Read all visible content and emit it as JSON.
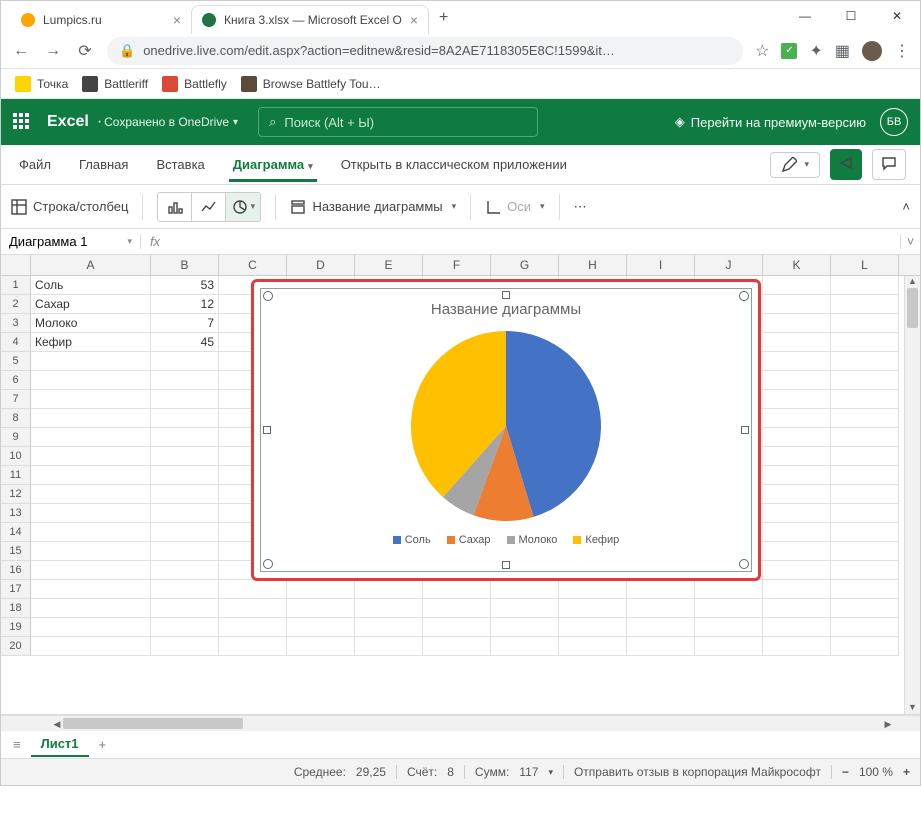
{
  "chrome": {
    "tabs": [
      {
        "title": "Lumpics.ru"
      },
      {
        "title": "Книга 3.xlsx — Microsoft Excel O"
      }
    ],
    "url": "onedrive.live.com/edit.aspx?action=editnew&resid=8A2AE7118305E8C!1599&it…",
    "bookmarks": [
      "Точка",
      "Battleriff",
      "Battlefly",
      "Browse Battlefy Tou…"
    ]
  },
  "excel_header": {
    "app": "Excel",
    "save_state": "Сохранено в OneDrive",
    "search_placeholder": "Поиск (Alt + Ы)",
    "premium": "Перейти на премиум-версию",
    "avatar_initials": "БВ"
  },
  "ribbon": {
    "tabs": [
      "Файл",
      "Главная",
      "Вставка",
      "Диаграмма"
    ],
    "active_tab": "Диаграмма",
    "open_desktop": "Открыть в классическом приложении"
  },
  "toolbar": {
    "swap_label": "Строка/столбец",
    "chart_title_label": "Название диаграммы",
    "axes_label": "Оси"
  },
  "namebox": "Диаграмма 1",
  "columns": [
    "A",
    "B",
    "C",
    "D",
    "E",
    "F",
    "G",
    "H",
    "I",
    "J",
    "K",
    "L"
  ],
  "row_count": 20,
  "cells": {
    "A1": "Соль",
    "B1": "53",
    "A2": "Сахар",
    "B2": "12",
    "A3": "Молоко",
    "B3": "7",
    "A4": "Кефир",
    "B4": "45"
  },
  "chart_data": {
    "type": "pie",
    "title": "Название диаграммы",
    "categories": [
      "Соль",
      "Сахар",
      "Молоко",
      "Кефир"
    ],
    "values": [
      53,
      12,
      7,
      45
    ],
    "colors": [
      "#4472c4",
      "#ed7d31",
      "#a5a5a5",
      "#ffc000"
    ]
  },
  "sheets": {
    "active": "Лист1"
  },
  "status": {
    "avg_label": "Среднее:",
    "avg": "29,25",
    "count_label": "Счёт:",
    "count": "8",
    "sum_label": "Сумм:",
    "sum": "117",
    "feedback": "Отправить отзыв в корпорация Майкрософт",
    "zoom": "100 %"
  }
}
